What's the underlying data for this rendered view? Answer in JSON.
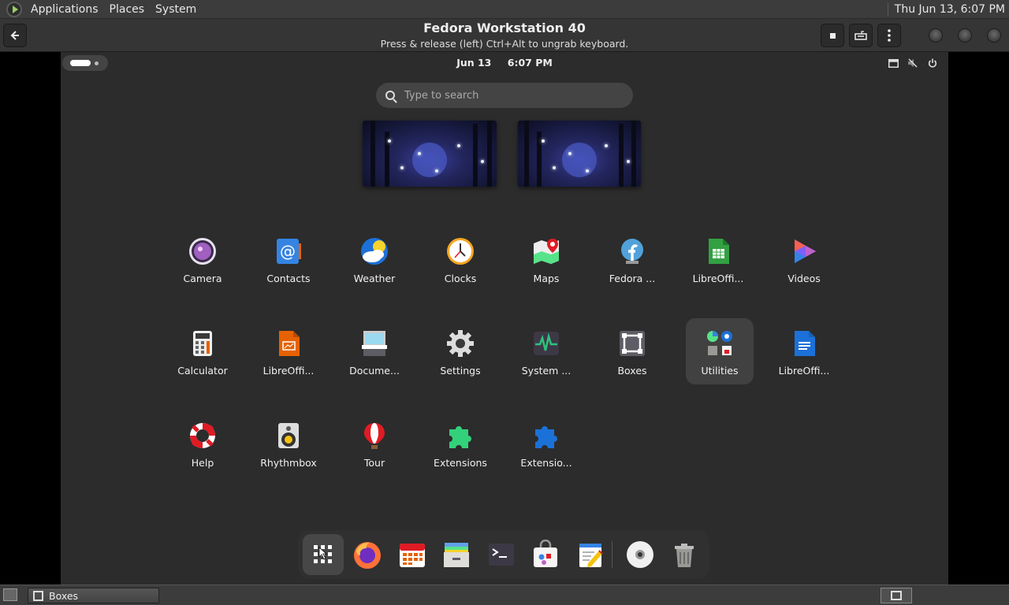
{
  "host_panel": {
    "menus": [
      "Applications",
      "Places",
      "System"
    ],
    "clock": "Thu Jun 13,  6:07 PM"
  },
  "boxes_header": {
    "title": "Fedora Workstation 40",
    "subtitle": "Press & release (left) Ctrl+Alt to ungrab keyboard."
  },
  "guest_top_bar": {
    "date": "Jun 13",
    "time": "6:07 PM"
  },
  "search": {
    "placeholder": "Type to search"
  },
  "app_grid": {
    "rows": [
      [
        {
          "name": "camera",
          "label": "Camera",
          "icon": "camera-icon"
        },
        {
          "name": "contacts",
          "label": "Contacts",
          "icon": "contacts-icon"
        },
        {
          "name": "weather",
          "label": "Weather",
          "icon": "weather-icon"
        },
        {
          "name": "clocks",
          "label": "Clocks",
          "icon": "clock-icon"
        },
        {
          "name": "maps",
          "label": "Maps",
          "icon": "map-icon"
        },
        {
          "name": "fedora-media-writer",
          "label": "Fedora ...",
          "icon": "fedora-icon"
        },
        {
          "name": "libreoffice-calc",
          "label": "LibreOffi...",
          "icon": "spreadsheet-icon"
        },
        {
          "name": "videos",
          "label": "Videos",
          "icon": "video-play-icon"
        }
      ],
      [
        {
          "name": "calculator",
          "label": "Calculator",
          "icon": "calculator-icon"
        },
        {
          "name": "libreoffice-impress",
          "label": "LibreOffi...",
          "icon": "presentation-icon"
        },
        {
          "name": "document-scanner",
          "label": "Docume...",
          "icon": "scanner-icon"
        },
        {
          "name": "settings",
          "label": "Settings",
          "icon": "gear-icon"
        },
        {
          "name": "system-monitor",
          "label": "System ...",
          "icon": "system-monitor-icon"
        },
        {
          "name": "boxes",
          "label": "Boxes",
          "icon": "boxes-icon"
        },
        {
          "name": "utilities",
          "label": "Utilities",
          "icon": "folder-grid-icon"
        },
        {
          "name": "libreoffice-writer",
          "label": "LibreOffi...",
          "icon": "document-icon"
        }
      ],
      [
        {
          "name": "help",
          "label": "Help",
          "icon": "lifebuoy-icon"
        },
        {
          "name": "rhythmbox",
          "label": "Rhythmbox",
          "icon": "speaker-icon"
        },
        {
          "name": "tour",
          "label": "Tour",
          "icon": "balloon-icon"
        },
        {
          "name": "extensions",
          "label": "Extensions",
          "icon": "puzzle-green-icon"
        },
        {
          "name": "extension-manager",
          "label": "Extensio...",
          "icon": "puzzle-blue-icon"
        }
      ]
    ]
  },
  "dock": {
    "items": [
      "show-apps-icon",
      "firefox-icon",
      "calendar-icon",
      "files-icon",
      "terminal-icon",
      "software-icon",
      "text-editor-icon",
      "disc-icon",
      "trash-icon"
    ]
  },
  "host_taskbar": {
    "task_label": "Boxes"
  },
  "colors": {
    "guest_bg": "#2c2c2c",
    "host_panel": "#3c3c3c",
    "selected_tile": "#414141"
  }
}
